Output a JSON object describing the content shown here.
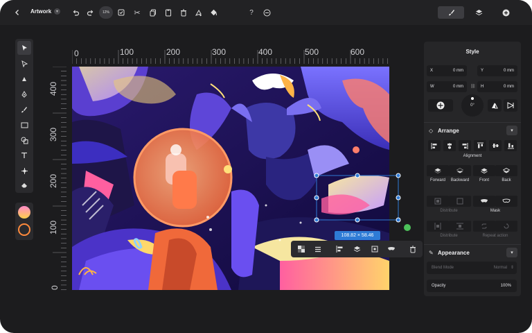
{
  "topbar": {
    "doc_title": "Artwork",
    "zoom": "12%",
    "help": "?",
    "icons": [
      "back-icon",
      "undo-icon",
      "redo-icon",
      "check-square-icon",
      "cut-icon",
      "copy-icon",
      "paste-icon",
      "trash-icon",
      "fill-icon",
      "paint-bucket-icon",
      "help-icon",
      "minus-circle-icon"
    ],
    "tabs": [
      "brush-tab",
      "layers-tab",
      "add-tab"
    ]
  },
  "rulers": {
    "top": [
      "0",
      "100",
      "200",
      "300",
      "400",
      "500",
      "600"
    ],
    "left": [
      "400",
      "300",
      "200",
      "100",
      "0"
    ]
  },
  "selection": {
    "size_label": "108.82 × 58.46"
  },
  "floatbar_icons": [
    "checker-icon",
    "menu-icon",
    "align-icon",
    "layers-icon",
    "crop-icon",
    "mask-icon",
    "trash-icon"
  ],
  "panel": {
    "style_title": "Style",
    "x": {
      "label": "X",
      "value": "0 mm"
    },
    "y": {
      "label": "Y",
      "value": "0 mm"
    },
    "w": {
      "label": "W",
      "value": "0 mm"
    },
    "h": {
      "label": "H",
      "value": "0 mm"
    },
    "rotation": "0°",
    "arrange_title": "Arrange",
    "alignment_label": "Alignment",
    "order": [
      "Forward",
      "Backward",
      "Front",
      "Back"
    ],
    "distribute": "Distribute",
    "mask": "Mask",
    "distribute2": "Distribute",
    "repeat_action": "Repeat action",
    "appearance_title": "Appearance",
    "blend_mode_label": "Blend Mode",
    "blend_mode_value": "Normal",
    "opacity_label": "Opacity",
    "opacity_value": "100%"
  },
  "colors": {
    "background": "#1c1c1e",
    "panel": "#262628",
    "accent": "#2e7bd6",
    "handle": "#ff8a3c",
    "green_handle": "#4cc25a"
  }
}
